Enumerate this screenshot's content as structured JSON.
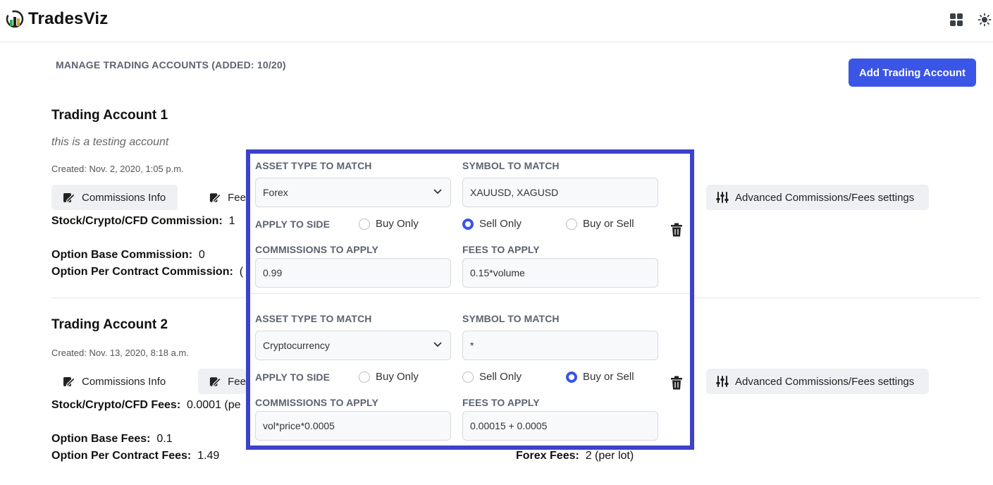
{
  "app": {
    "name": "TradesViz"
  },
  "page": {
    "manage_title": "MANAGE TRADING ACCOUNTS (ADDED: 10/20)",
    "add_button": "Add Trading Account"
  },
  "accounts": [
    {
      "name": "Trading Account 1",
      "description": "this is a testing account",
      "created": "Created: Nov. 2, 2020, 1:05 p.m.",
      "buttons": {
        "commissions": "Commissions Info",
        "fees": "Fee",
        "advanced": "Advanced Commissions/Fees settings"
      },
      "fields": [
        {
          "label": "Stock/Crypto/CFD Commission:",
          "value": "1"
        },
        {
          "label": "Option Base Commission:",
          "value": "0"
        },
        {
          "label": "Option Per Contract Commission:",
          "value": "("
        }
      ]
    },
    {
      "name": "Trading Account 2",
      "created": "Created: Nov. 13, 2020, 8:18 a.m.",
      "buttons": {
        "commissions": "Commissions Info",
        "fees": "Fee",
        "advanced": "Advanced Commissions/Fees settings"
      },
      "fields": [
        {
          "label": "Stock/Crypto/CFD Fees:",
          "value": "0.0001 (pe"
        },
        {
          "label": "Option Base Fees:",
          "value": "0.1"
        },
        {
          "label": "Option Per Contract Fees:",
          "value": "1.49"
        },
        {
          "label": "Forex Fees:",
          "value": "2 (per lot)"
        }
      ]
    }
  ],
  "rules": {
    "labels": {
      "asset_type": "ASSET TYPE TO MATCH",
      "symbol": "SYMBOL TO MATCH",
      "side": "APPLY TO SIDE",
      "commissions": "COMMISSIONS TO APPLY",
      "fees": "FEES TO APPLY"
    },
    "side_options": [
      "Buy Only",
      "Sell Only",
      "Buy or Sell"
    ],
    "items": [
      {
        "asset_type": "Forex",
        "symbol": "XAUUSD, XAGUSD",
        "selected_side": "Sell Only",
        "commissions": "0.99",
        "fees": "0.15*volume"
      },
      {
        "asset_type": "Cryptocurrency",
        "symbol": "*",
        "selected_side": "Buy or Sell",
        "commissions": "vol*price*0.0005",
        "fees": "0.00015 + 0.0005"
      }
    ]
  },
  "colors": {
    "accent": "#3b55e6",
    "panel_border": "#3c42c9"
  }
}
